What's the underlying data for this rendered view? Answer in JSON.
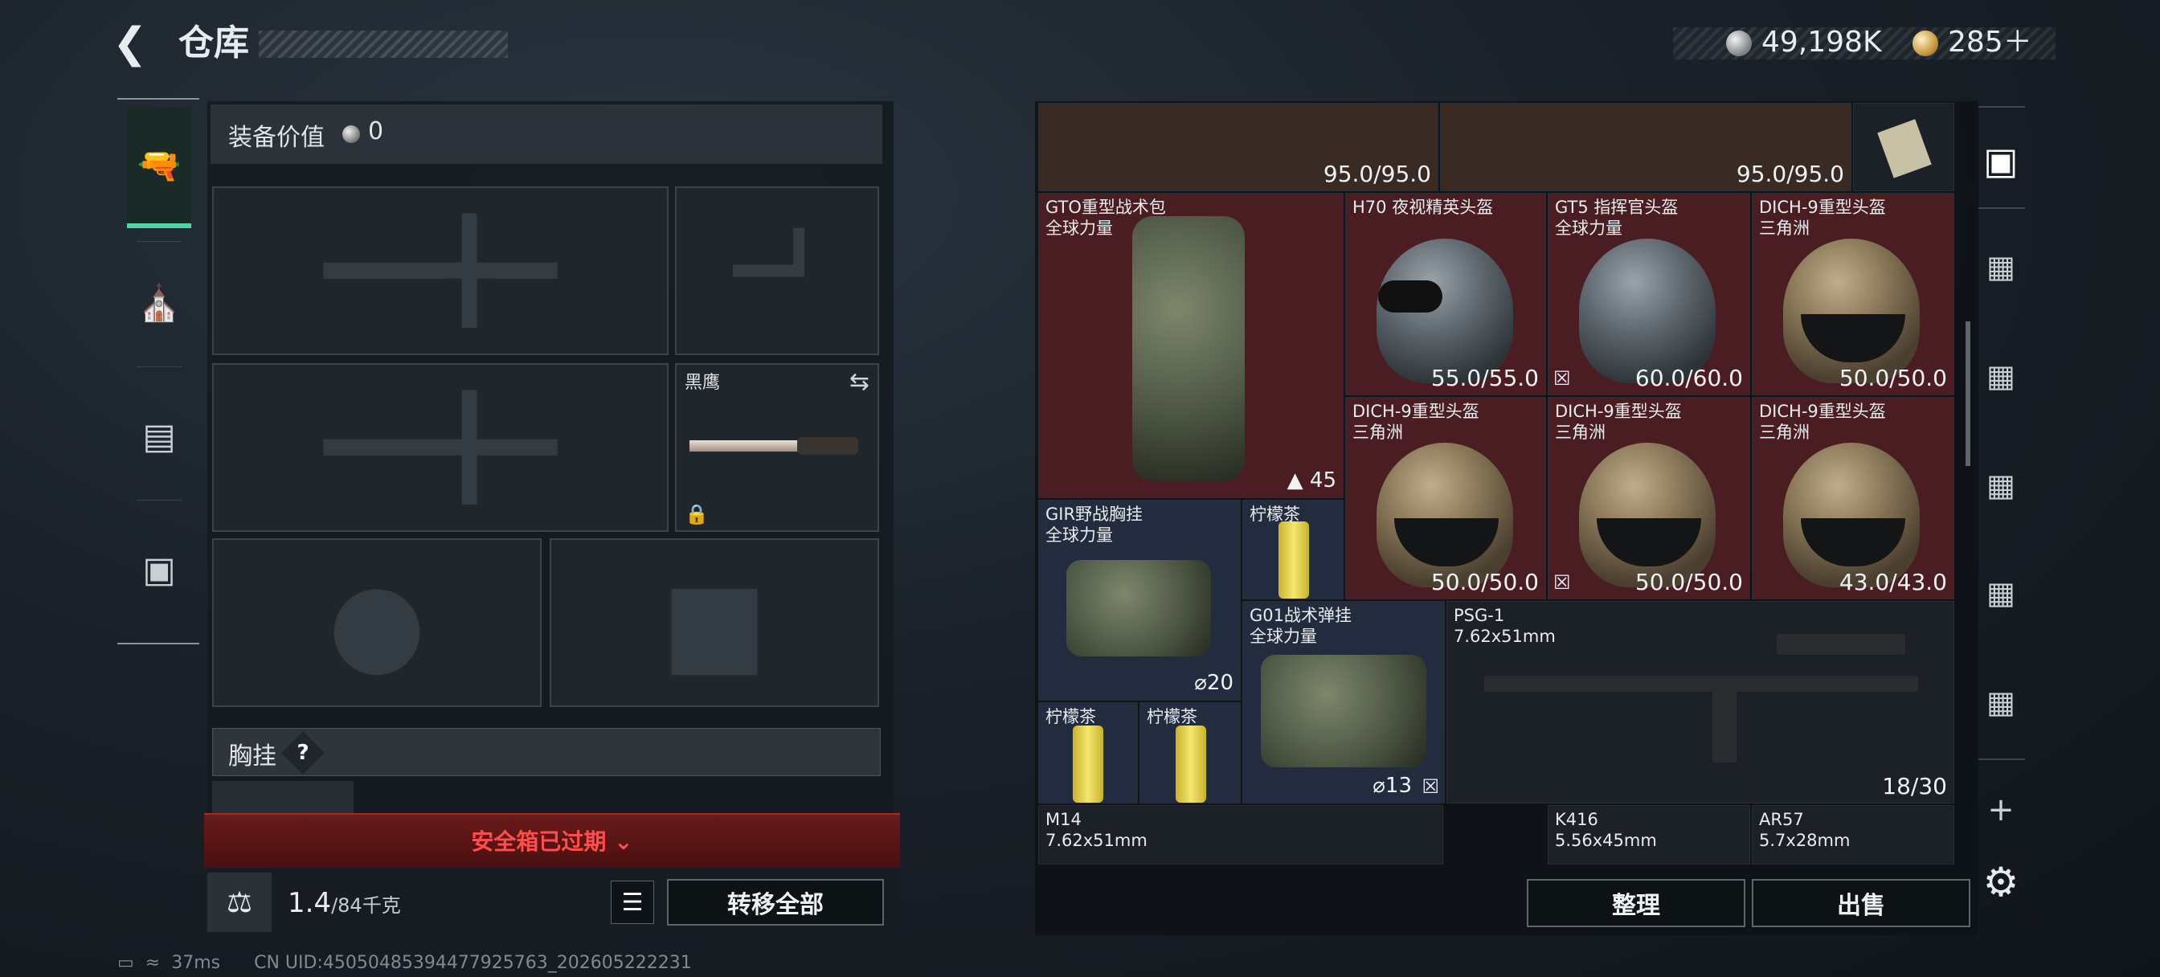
{
  "header": {
    "title": "仓库",
    "silver": "49,198K",
    "gold": "285＋"
  },
  "equipment": {
    "value_label": "装备价值",
    "value": "0",
    "melee_name": "黑鹰",
    "section_label": "胸挂",
    "help": "?",
    "safe_box_status": "安全箱已过期",
    "weight_current": "1.4",
    "weight_max": "/84千克",
    "transfer_all": "转移全部"
  },
  "nav": {
    "icons": [
      "pistol-icon",
      "helmet-icon",
      "backpack-icon",
      "toolbox-icon"
    ]
  },
  "inventory": {
    "top_row": [
      {
        "durability": "95.0/95.0"
      },
      {
        "durability": "95.0/95.0"
      }
    ],
    "items": {
      "backpack_gto": {
        "name": "GTO重型战术包",
        "sub": "全球力量",
        "badge": "45"
      },
      "helmet_h70": {
        "name": "H70 夜视精英头盔",
        "durability": "55.0/55.0"
      },
      "helmet_gt5": {
        "name": "GT5 指挥官头盔",
        "sub": "全球力量",
        "durability": "60.0/60.0"
      },
      "helmet_dich1": {
        "name": "DICH-9重型头盔",
        "sub": "三角洲",
        "durability": "50.0/50.0"
      },
      "helmet_dich2": {
        "name": "DICH-9重型头盔",
        "sub": "三角洲",
        "durability": "50.0/50.0"
      },
      "helmet_dich3": {
        "name": "DICH-9重型头盔",
        "sub": "三角洲",
        "durability": "50.0/50.0"
      },
      "helmet_dich4": {
        "name": "DICH-9重型头盔",
        "sub": "三角洲",
        "durability": "43.0/43.0"
      },
      "vest_gir": {
        "name": "GIR野战胸挂",
        "sub": "全球力量",
        "badge": "20"
      },
      "tea1": {
        "name": "柠檬茶"
      },
      "tea2": {
        "name": "柠檬茶"
      },
      "tea3": {
        "name": "柠檬茶"
      },
      "rig_g01": {
        "name": "G01战术弹挂",
        "sub": "全球力量",
        "badge": "13"
      },
      "psg1": {
        "name": "PSG-1",
        "sub": "7.62x51mm",
        "ammo": "18/30"
      },
      "m14": {
        "name": "M14",
        "sub": "7.62x51mm"
      },
      "k416": {
        "name": "K416",
        "sub": "5.56x45mm"
      },
      "ar57": {
        "name": "AR57",
        "sub": "5.7x28mm"
      }
    },
    "sort_label": "整理",
    "sell_label": "出售"
  },
  "status": {
    "ping": "37ms",
    "uid": "CN UID:45050485394477925763_202605222231"
  }
}
